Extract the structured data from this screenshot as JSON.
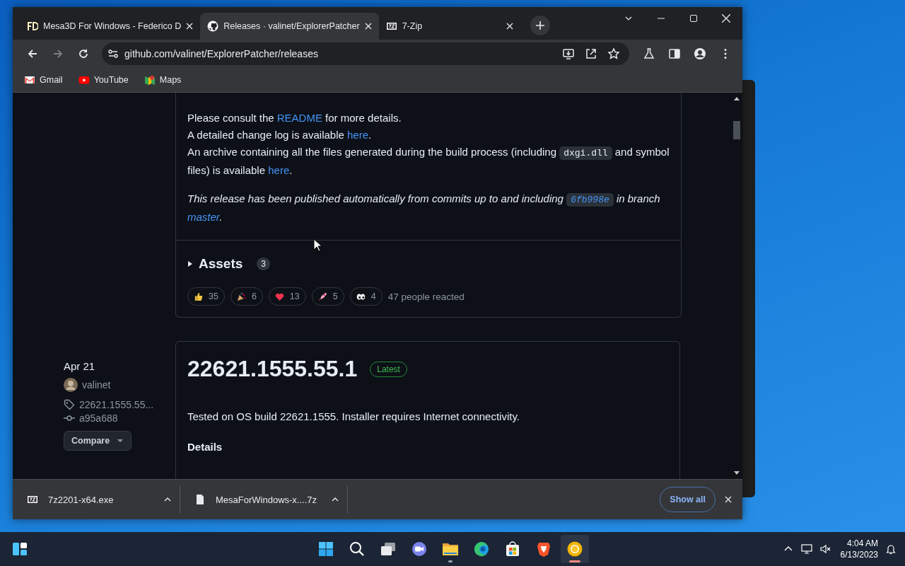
{
  "tabs": [
    {
      "label": "Mesa3D For Windows - Federico D",
      "selected": false
    },
    {
      "label": "Releases · valinet/ExplorerPatcher",
      "selected": true
    },
    {
      "label": "7-Zip",
      "selected": false
    }
  ],
  "address": "github.com/valinet/ExplorerPatcher/releases",
  "bookmarks": [
    {
      "label": "Gmail"
    },
    {
      "label": "YouTube"
    },
    {
      "label": "Maps"
    }
  ],
  "release_notes": [
    [
      {
        "kind": "text",
        "text": "Please consult the "
      },
      {
        "kind": "link",
        "text": "README"
      },
      {
        "kind": "text",
        "text": " for more details."
      }
    ],
    [
      {
        "kind": "text",
        "text": "A detailed change log is available "
      },
      {
        "kind": "link",
        "text": "here"
      },
      {
        "kind": "text",
        "text": "."
      }
    ],
    [
      {
        "kind": "text",
        "text": "An archive containing all the files generated during the build process (including "
      },
      {
        "kind": "code",
        "text": "dxgi.dll"
      },
      {
        "kind": "text",
        "text": " and symbol files) is available "
      },
      {
        "kind": "link",
        "text": "here"
      },
      {
        "kind": "text",
        "text": "."
      }
    ]
  ],
  "publish_note": [
    {
      "kind": "text",
      "text": "This release has been published automatically from commits up to and including "
    },
    {
      "kind": "code_link",
      "text": "6fb998e"
    },
    {
      "kind": "text",
      "text": " in branch "
    },
    {
      "kind": "link",
      "text": "master"
    },
    {
      "kind": "text",
      "text": "."
    }
  ],
  "assets": {
    "label": "Assets",
    "count": "3",
    "expanded": false
  },
  "reactions": [
    {
      "kind": "thumbs_up",
      "count": "35"
    },
    {
      "kind": "party",
      "count": "6"
    },
    {
      "kind": "heart",
      "count": "13"
    },
    {
      "kind": "rocket",
      "count": "5"
    },
    {
      "kind": "eyes",
      "count": "4"
    }
  ],
  "reaction_summary": "47 people reacted",
  "release": {
    "date": "Apr 21",
    "author": "valinet",
    "tag": "22621.1555.55...",
    "commit": "a95a688",
    "compare": "Compare",
    "title": "22621.1555.55.1",
    "badge": "Latest",
    "description": "Tested on OS build 22621.1555. Installer requires Internet connectivity.",
    "heading": "Details"
  },
  "downloads": [
    {
      "name": "7z2201-x64.exe"
    },
    {
      "name": "MesaForWindows-x....7z"
    }
  ],
  "show_all": "Show all",
  "taskbar": {
    "apps": [
      {
        "kind": "start",
        "open": false,
        "selected": false
      },
      {
        "kind": "search",
        "open": false,
        "selected": false
      },
      {
        "kind": "task_view",
        "open": false,
        "selected": false
      },
      {
        "kind": "chat",
        "open": false,
        "selected": false
      },
      {
        "kind": "files",
        "open": true,
        "selected": false
      },
      {
        "kind": "edge",
        "open": false,
        "selected": false
      },
      {
        "kind": "store",
        "open": false,
        "selected": false
      },
      {
        "kind": "brave",
        "open": false,
        "selected": false
      },
      {
        "kind": "canary",
        "open": true,
        "selected": true
      }
    ],
    "time": "4:04 AM",
    "date": "6/13/2023"
  }
}
